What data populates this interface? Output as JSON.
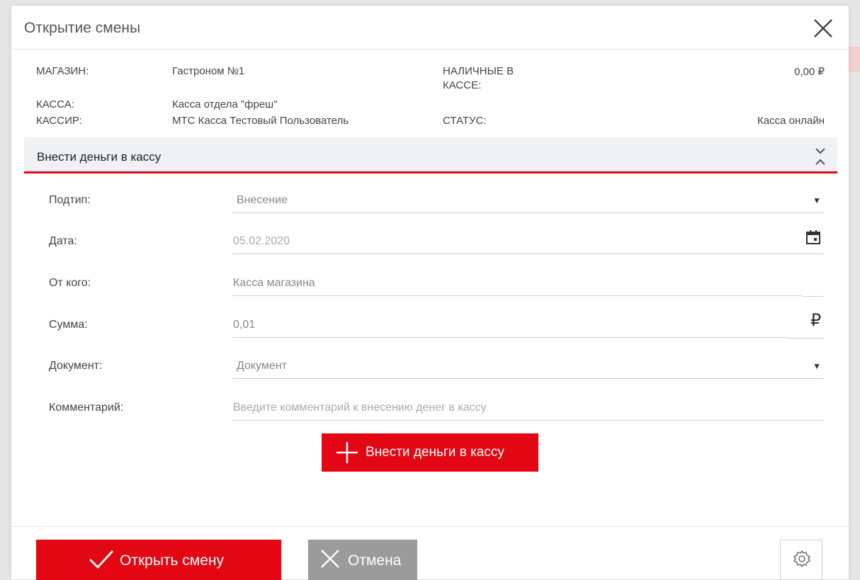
{
  "dialog": {
    "title": "Открытие смены"
  },
  "info": {
    "store_label": "МАГАЗИН:",
    "store_value": "Гастроном №1",
    "cash_label_line1": "НАЛИЧНЫЕ В",
    "cash_label_line2": "КАССЕ:",
    "cash_value": "0,00 ₽",
    "register_label": "КАССА:",
    "register_value": "Касса отдела \"фреш\"",
    "cashier_label": "КАССИР:",
    "cashier_value": "МТС Касса Тестовый Пользователь",
    "status_label": "СТАТУС:",
    "status_value": "Касса онлайн"
  },
  "section": {
    "title": "Внести деньги в кассу",
    "fields": {
      "subtype": {
        "label": "Подтип:",
        "value": "Внесение"
      },
      "date": {
        "label": "Дата:",
        "value": "05.02.2020"
      },
      "from": {
        "label": "От кого:",
        "value": "Касса магазина"
      },
      "amount": {
        "label": "Сумма:",
        "value": "0,01",
        "suffix": "₽"
      },
      "document": {
        "label": "Документ:",
        "value": "Документ"
      },
      "comment": {
        "label": "Комментарий:",
        "placeholder": "Введите комментарий к внесению денег в кассу"
      }
    },
    "add_button": "Внести деньги в кассу"
  },
  "footer": {
    "open_button": "Открыть смену",
    "cancel_button": "Отмена"
  },
  "colors": {
    "accent": "#e30613",
    "cancel": "#9b9b9b"
  },
  "icons": [
    "close-icon",
    "collapse-icon",
    "dropdown-arrow-icon",
    "calendar-icon",
    "ruble-icon",
    "plus-icon",
    "check-icon",
    "settings-icon"
  ]
}
